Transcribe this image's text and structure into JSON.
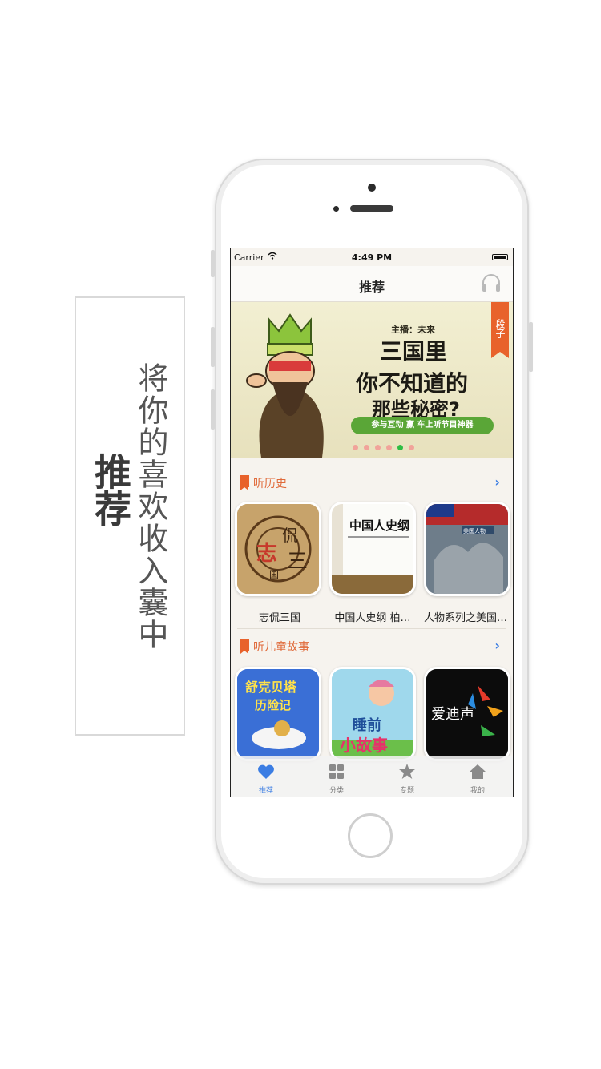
{
  "promo": {
    "title": "推荐",
    "tagline": "将你的喜欢收入囊中"
  },
  "status_bar": {
    "carrier": "Carrier",
    "time": "4:49 PM"
  },
  "nav": {
    "title": "推荐",
    "right_icon": "headphone-icon"
  },
  "banner": {
    "tag": "段子",
    "host": "主播：未来",
    "line1": "三国里",
    "line2": "你不知道的",
    "line3": "那些秘密?",
    "strip": "参与互动 赢 车上听节目神器",
    "active_dot_index": 4,
    "dot_count": 6
  },
  "sections": [
    {
      "title": "听历史",
      "items": [
        "志侃三国",
        "中国人史纲 柏…",
        "人物系列之美国…"
      ]
    },
    {
      "title": "听儿童故事",
      "items": [
        "舒克贝塔历险记",
        "睡前小故事",
        "爱迪声"
      ]
    }
  ],
  "covers": {
    "c1_text_a": "侃",
    "c1_text_b": "志",
    "c1_text_c": "国",
    "c1_text_d": "三",
    "c2_title": "中国人史纲",
    "c3_banner": "美国人物",
    "c4_text": "舒克贝塔",
    "c4_sub": "历险记",
    "c5_text": "睡前",
    "c5_sub": "小故事",
    "c6_text": "爱迪声"
  },
  "tabs": [
    {
      "label": "推荐",
      "icon": "heart-icon",
      "active": true
    },
    {
      "label": "分类",
      "icon": "grid-icon",
      "active": false
    },
    {
      "label": "专题",
      "icon": "star-icon",
      "active": false
    },
    {
      "label": "我的",
      "icon": "home-icon",
      "active": false
    }
  ],
  "colors": {
    "accent": "#3b7de3",
    "section_title": "#e06a3a",
    "banner_green": "#5aa637",
    "tag_orange": "#e8622b"
  }
}
